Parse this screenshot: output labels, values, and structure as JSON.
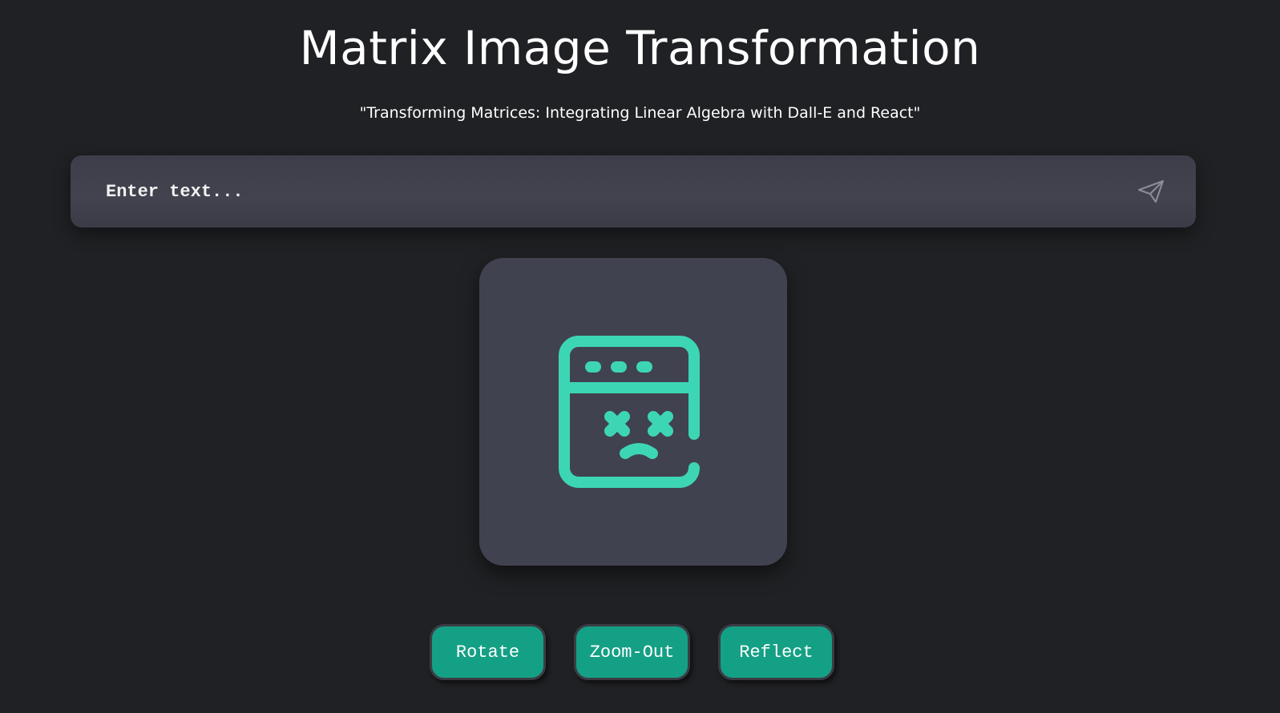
{
  "header": {
    "title": "Matrix Image Transformation",
    "subtitle": "\"Transforming Matrices: Integrating Linear Algebra with Dall-E and React\""
  },
  "prompt": {
    "value": "",
    "placeholder": "Enter text...",
    "send_icon": "paper-plane-icon"
  },
  "image_area": {
    "icon": "browser-error-sad-face-icon",
    "icon_color": "#3dd6b5"
  },
  "actions": {
    "rotate_label": "Rotate",
    "zoom_out_label": "Zoom-Out",
    "reflect_label": "Reflect"
  },
  "colors": {
    "background": "#202124",
    "panel": "#41424f",
    "button": "#14a085",
    "accent": "#3dd6b5"
  }
}
